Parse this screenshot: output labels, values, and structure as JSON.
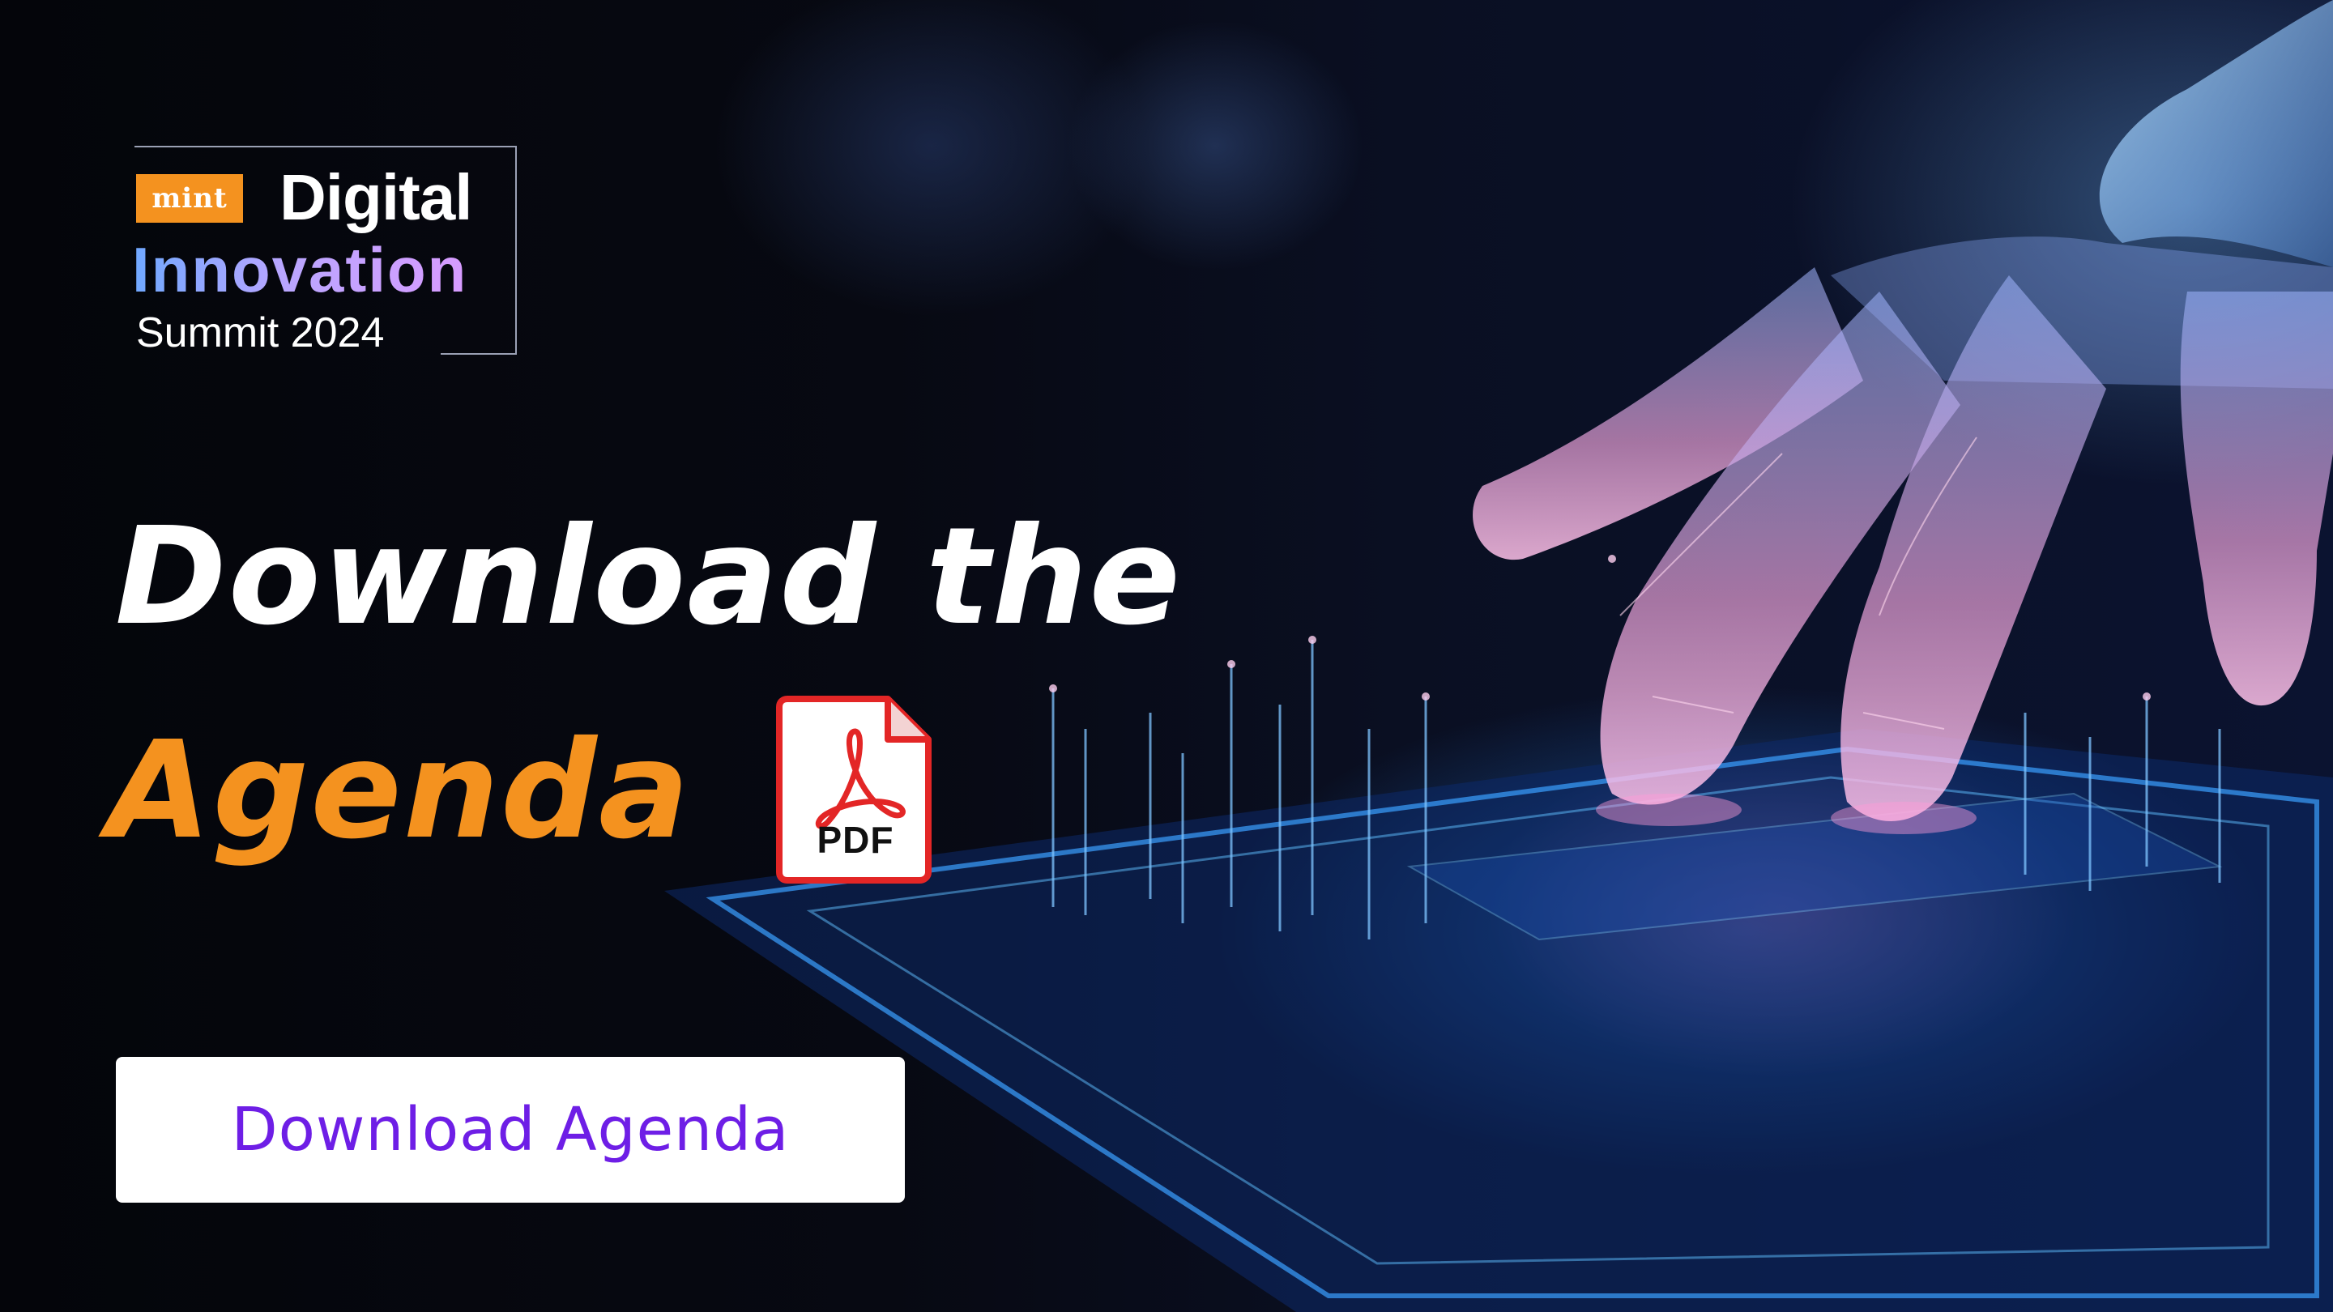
{
  "logo": {
    "brand": "mint",
    "line1": "Digital",
    "line2": "Innovation",
    "line3": "Summit 2024"
  },
  "headline": {
    "line1": "Download the",
    "line2": "Agenda"
  },
  "pdf_icon": {
    "icon": "pdf-file-icon",
    "label": "PDF"
  },
  "cta": {
    "label": "Download Agenda"
  },
  "colors": {
    "accent_orange": "#f4921f",
    "cta_text_purple": "#6e1ee6",
    "background": "#05060d",
    "pdf_red": "#e32626"
  }
}
